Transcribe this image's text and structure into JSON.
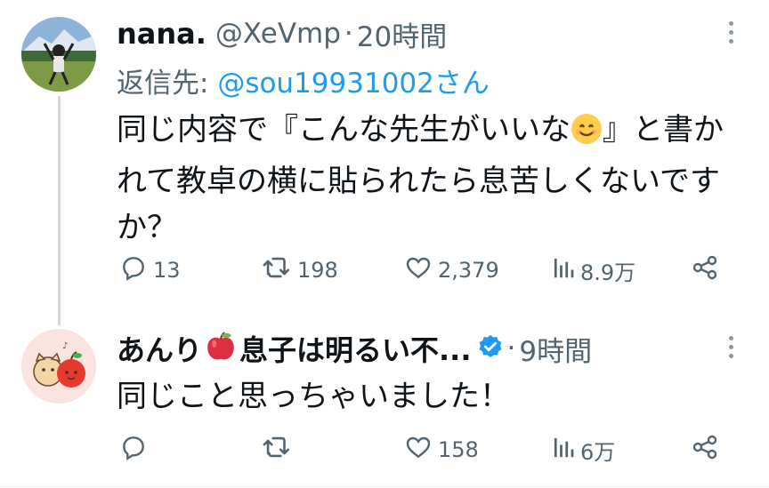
{
  "tweet1": {
    "name": "nana.",
    "handle": "@XeVmp",
    "separator": "·",
    "time": "20時間",
    "reply_prefix": "返信先: ",
    "reply_mention": "@sou19931002さん",
    "text_before_emoji": "同じ内容で『こんな先生がいいな",
    "emoji": "smiling-face-emoji",
    "text_after_emoji": "』と書かれて教卓の横に貼られたら息苦しくないですか？",
    "replies": "13",
    "retweets": "198",
    "likes": "2,379",
    "views": "8.9万"
  },
  "tweet2": {
    "name_part1": "あんり",
    "name_emoji": "apple-emoji",
    "name_part2": "息子は明るい不...",
    "separator": "·",
    "time": "9時間",
    "text": "同じこと思っちゃいました！",
    "replies": "",
    "retweets": "",
    "likes": "158",
    "views": "6万"
  },
  "colors": {
    "text": "#0f1419",
    "secondary": "#536471",
    "accent": "#1d9bf0",
    "thread_line": "#cfd9de"
  }
}
